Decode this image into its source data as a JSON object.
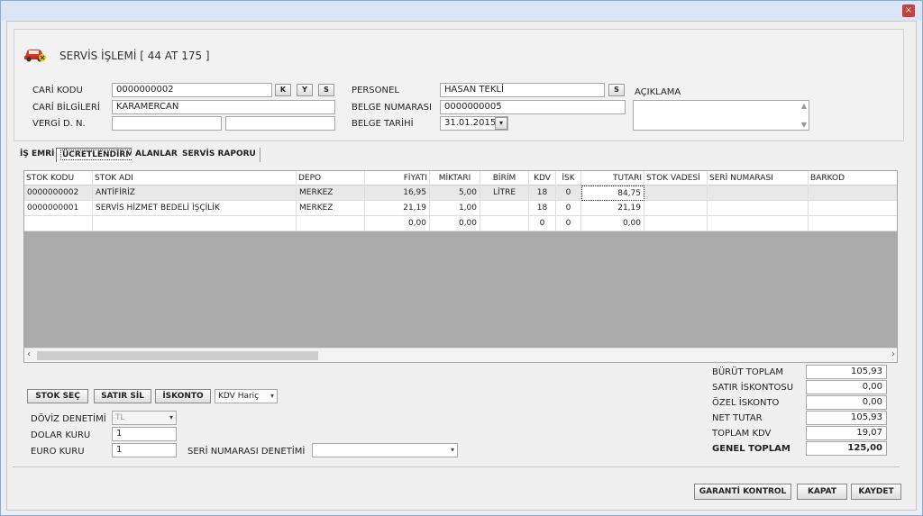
{
  "window": {
    "close_symbol": "×"
  },
  "header": {
    "title": "SERVİS İŞLEMİ [ 44 AT 175 ]",
    "icon": "car-service-icon"
  },
  "form": {
    "cari_kodu_label": "CARİ KODU",
    "cari_kodu_value": "0000000002",
    "btn_k": "K",
    "btn_y": "Y",
    "btn_s": "S",
    "cari_bilgileri_label": "CARİ BİLGİLERİ",
    "cari_bilgileri_value": "KARAMERCAN",
    "vergi_label": "VERGİ D. N.",
    "vergi_value_1": "",
    "vergi_value_2": "",
    "personel_label": "PERSONEL",
    "personel_value": "HASAN TEKLİ",
    "personel_btn": "S",
    "belge_no_label": "BELGE NUMARASI",
    "belge_no_value": "0000000005",
    "belge_tarihi_label": "BELGE TARİHİ",
    "belge_tarihi_value": "31.01.2015",
    "aciklama_label": "AÇIKLAMA"
  },
  "tabs": [
    {
      "label": "İŞ EMRİ"
    },
    {
      "label": "ÜCRETLENDİRME"
    },
    {
      "label": "ALANLAR"
    },
    {
      "label": "SERVİS RAPORU"
    }
  ],
  "grid": {
    "columns": [
      "STOK KODU",
      "STOK ADI",
      "DEPO",
      "FİYATI",
      "MİKTARI",
      "BİRİM",
      "KDV",
      "İSK",
      "TUTARI",
      "STOK VADESİ",
      "SERİ NUMARASI",
      "BARKOD"
    ],
    "rows": [
      [
        "0000000002",
        "ANTİFİRİZ",
        "MERKEZ",
        "16,95",
        "5,00",
        "LİTRE",
        "18",
        "0",
        "84,75",
        "",
        "",
        ""
      ],
      [
        "0000000001",
        "SERVİS HİZMET BEDELİ İŞÇİLİK",
        "MERKEZ",
        "21,19",
        "1,00",
        "",
        "18",
        "0",
        "21,19",
        "",
        "",
        ""
      ],
      [
        "",
        "",
        "",
        "0,00",
        "0,00",
        "",
        "0",
        "0",
        "0,00",
        "",
        "",
        ""
      ]
    ]
  },
  "actions": {
    "stok_sec": "STOK SEÇ",
    "satir_sil": "SATIR SİL",
    "iskonto": "İSKONTO",
    "kdv_select": "KDV Hariç"
  },
  "currency": {
    "doviz_label": "DÖVİZ DENETİMİ",
    "doviz_value": "TL",
    "dolar_label": "DOLAR KURU",
    "dolar_value": "1",
    "euro_label": "EURO KURU",
    "euro_value": "1",
    "seri_label": "SERİ NUMARASI DENETİMİ",
    "seri_value": ""
  },
  "totals": {
    "brut_label": "BÜRÜT TOPLAM",
    "brut_value": "105,93",
    "satir_isk_label": "SATIR İSKONTOSU",
    "satir_isk_value": "0,00",
    "ozel_isk_label": "ÖZEL İSKONTO",
    "ozel_isk_value": "0,00",
    "net_label": "NET TUTAR",
    "net_value": "105,93",
    "kdv_label": "TOPLAM KDV",
    "kdv_value": "19,07",
    "genel_label": "GENEL TOPLAM",
    "genel_value": "125,00"
  },
  "footer": {
    "garanti": "GARANTİ KONTROL",
    "kapat": "KAPAT",
    "kaydet": "KAYDET"
  }
}
